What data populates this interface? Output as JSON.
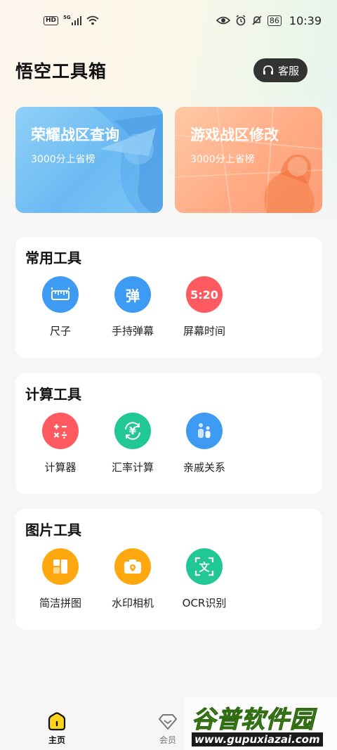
{
  "status_bar": {
    "hd": "HD",
    "network": "5G",
    "battery": "86",
    "time": "10:39"
  },
  "header": {
    "title": "悟空工具箱",
    "service_label": "客服"
  },
  "banners": [
    {
      "title": "荣耀战区查询",
      "subtitle": "3000分上省榜",
      "color": "#7cc3f5"
    },
    {
      "title": "游戏战区修改",
      "subtitle": "3000分上省榜",
      "color": "#ffab84"
    }
  ],
  "sections": [
    {
      "title": "常用工具",
      "tools": [
        {
          "label": "尺子",
          "icon": "ruler-icon",
          "color": "#3d9bf3"
        },
        {
          "label": "手持弹幕",
          "icon": "danmaku-icon",
          "glyph": "弹",
          "color": "#3d9bf3"
        },
        {
          "label": "屏幕时间",
          "icon": "clock-display-icon",
          "glyph": "5:20",
          "color": "#ff5a5f"
        }
      ]
    },
    {
      "title": "计算工具",
      "tools": [
        {
          "label": "计算器",
          "icon": "calculator-icon",
          "color": "#ff5a5f"
        },
        {
          "label": "汇率计算",
          "icon": "currency-exchange-icon",
          "glyph": "¥",
          "color": "#21c795"
        },
        {
          "label": "亲戚关系",
          "icon": "relatives-icon",
          "color": "#3d9bf3"
        }
      ]
    },
    {
      "title": "图片工具",
      "tools": [
        {
          "label": "简洁拼图",
          "icon": "collage-icon",
          "color": "#ffa70f"
        },
        {
          "label": "水印相机",
          "icon": "camera-icon",
          "color": "#ffa70f"
        },
        {
          "label": "OCR识别",
          "icon": "ocr-scan-icon",
          "glyph": "文",
          "color": "#21c795"
        }
      ]
    }
  ],
  "tabbar": {
    "tabs": [
      {
        "label": "主页",
        "icon": "home-icon",
        "active": true
      },
      {
        "label": "会员",
        "icon": "diamond-icon",
        "active": false
      }
    ]
  },
  "watermark": {
    "title": "谷普软件园",
    "url": "www.gupuxiazai.com"
  }
}
